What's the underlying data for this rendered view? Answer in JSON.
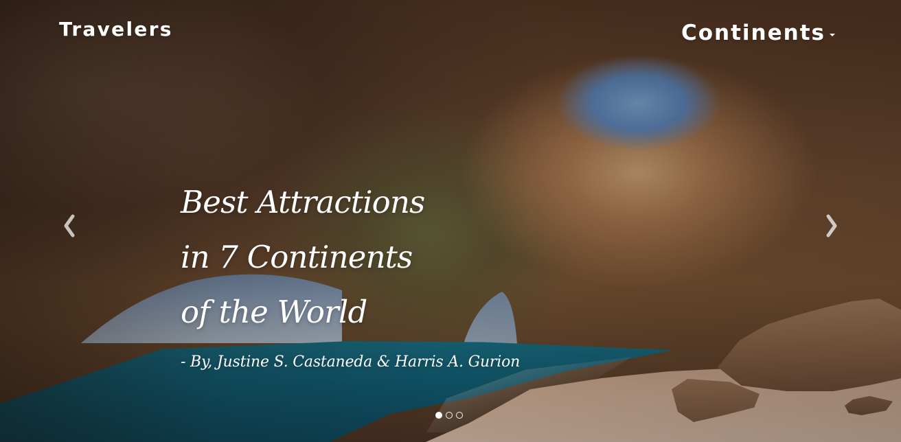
{
  "header": {
    "brand": "Travelers",
    "menu_label": "Continents"
  },
  "icons": {
    "dropdown": "chevron-down-icon",
    "previous": "chevron-left-icon",
    "next": "chevron-right-icon"
  },
  "hero": {
    "headline_lines": [
      "Best Attractions",
      "in 7 Continents",
      "of the World"
    ],
    "byline": "- By, Justine S. Castaneda & Harris A. Gurion"
  },
  "carousel": {
    "indicators": [
      {
        "active": true
      },
      {
        "active": false
      },
      {
        "active": false
      }
    ]
  }
}
